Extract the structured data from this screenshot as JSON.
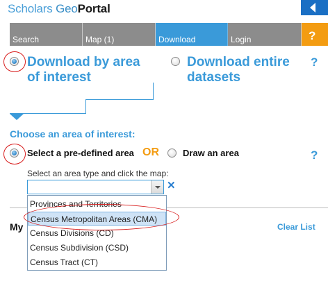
{
  "header": {
    "logo_part1": "Scholars",
    "logo_part2": " Geo",
    "logo_part3": "Portal",
    "collapse_icon": "chevron-left-icon"
  },
  "nav": {
    "tabs": [
      {
        "label": "Search"
      },
      {
        "label": "Map (1)"
      },
      {
        "label": "Download",
        "active": true
      },
      {
        "label": "Login"
      },
      {
        "label": "?"
      }
    ]
  },
  "download": {
    "option_area_line1": "Download by area",
    "option_area_line2": "of interest",
    "option_area_selected": true,
    "option_entire_line1": "Download entire",
    "option_entire_line2": "datasets",
    "help": "?"
  },
  "area": {
    "heading": "Choose an area of interest:",
    "predefined_label": "Select a pre-defined area",
    "or_label": "OR",
    "draw_label": "Draw an area",
    "help": "?",
    "instruction": "Select an area type and click the map:",
    "select_value": "",
    "clear_symbol": "✕",
    "options": [
      "Provinces and Territories",
      "Census Metropolitan Areas (CMA)",
      "Census Divisions (CD)",
      "Census Subdivision (CSD)",
      "Census Tract (CT)"
    ],
    "highlighted_index": 1
  },
  "mylist": {
    "label": "My",
    "clear_list": "Clear List"
  },
  "colors": {
    "accent": "#3a9ad9",
    "nav_gray": "#8c8c8c",
    "help_orange": "#f39c12",
    "annotation_red": "#d81e1e"
  }
}
